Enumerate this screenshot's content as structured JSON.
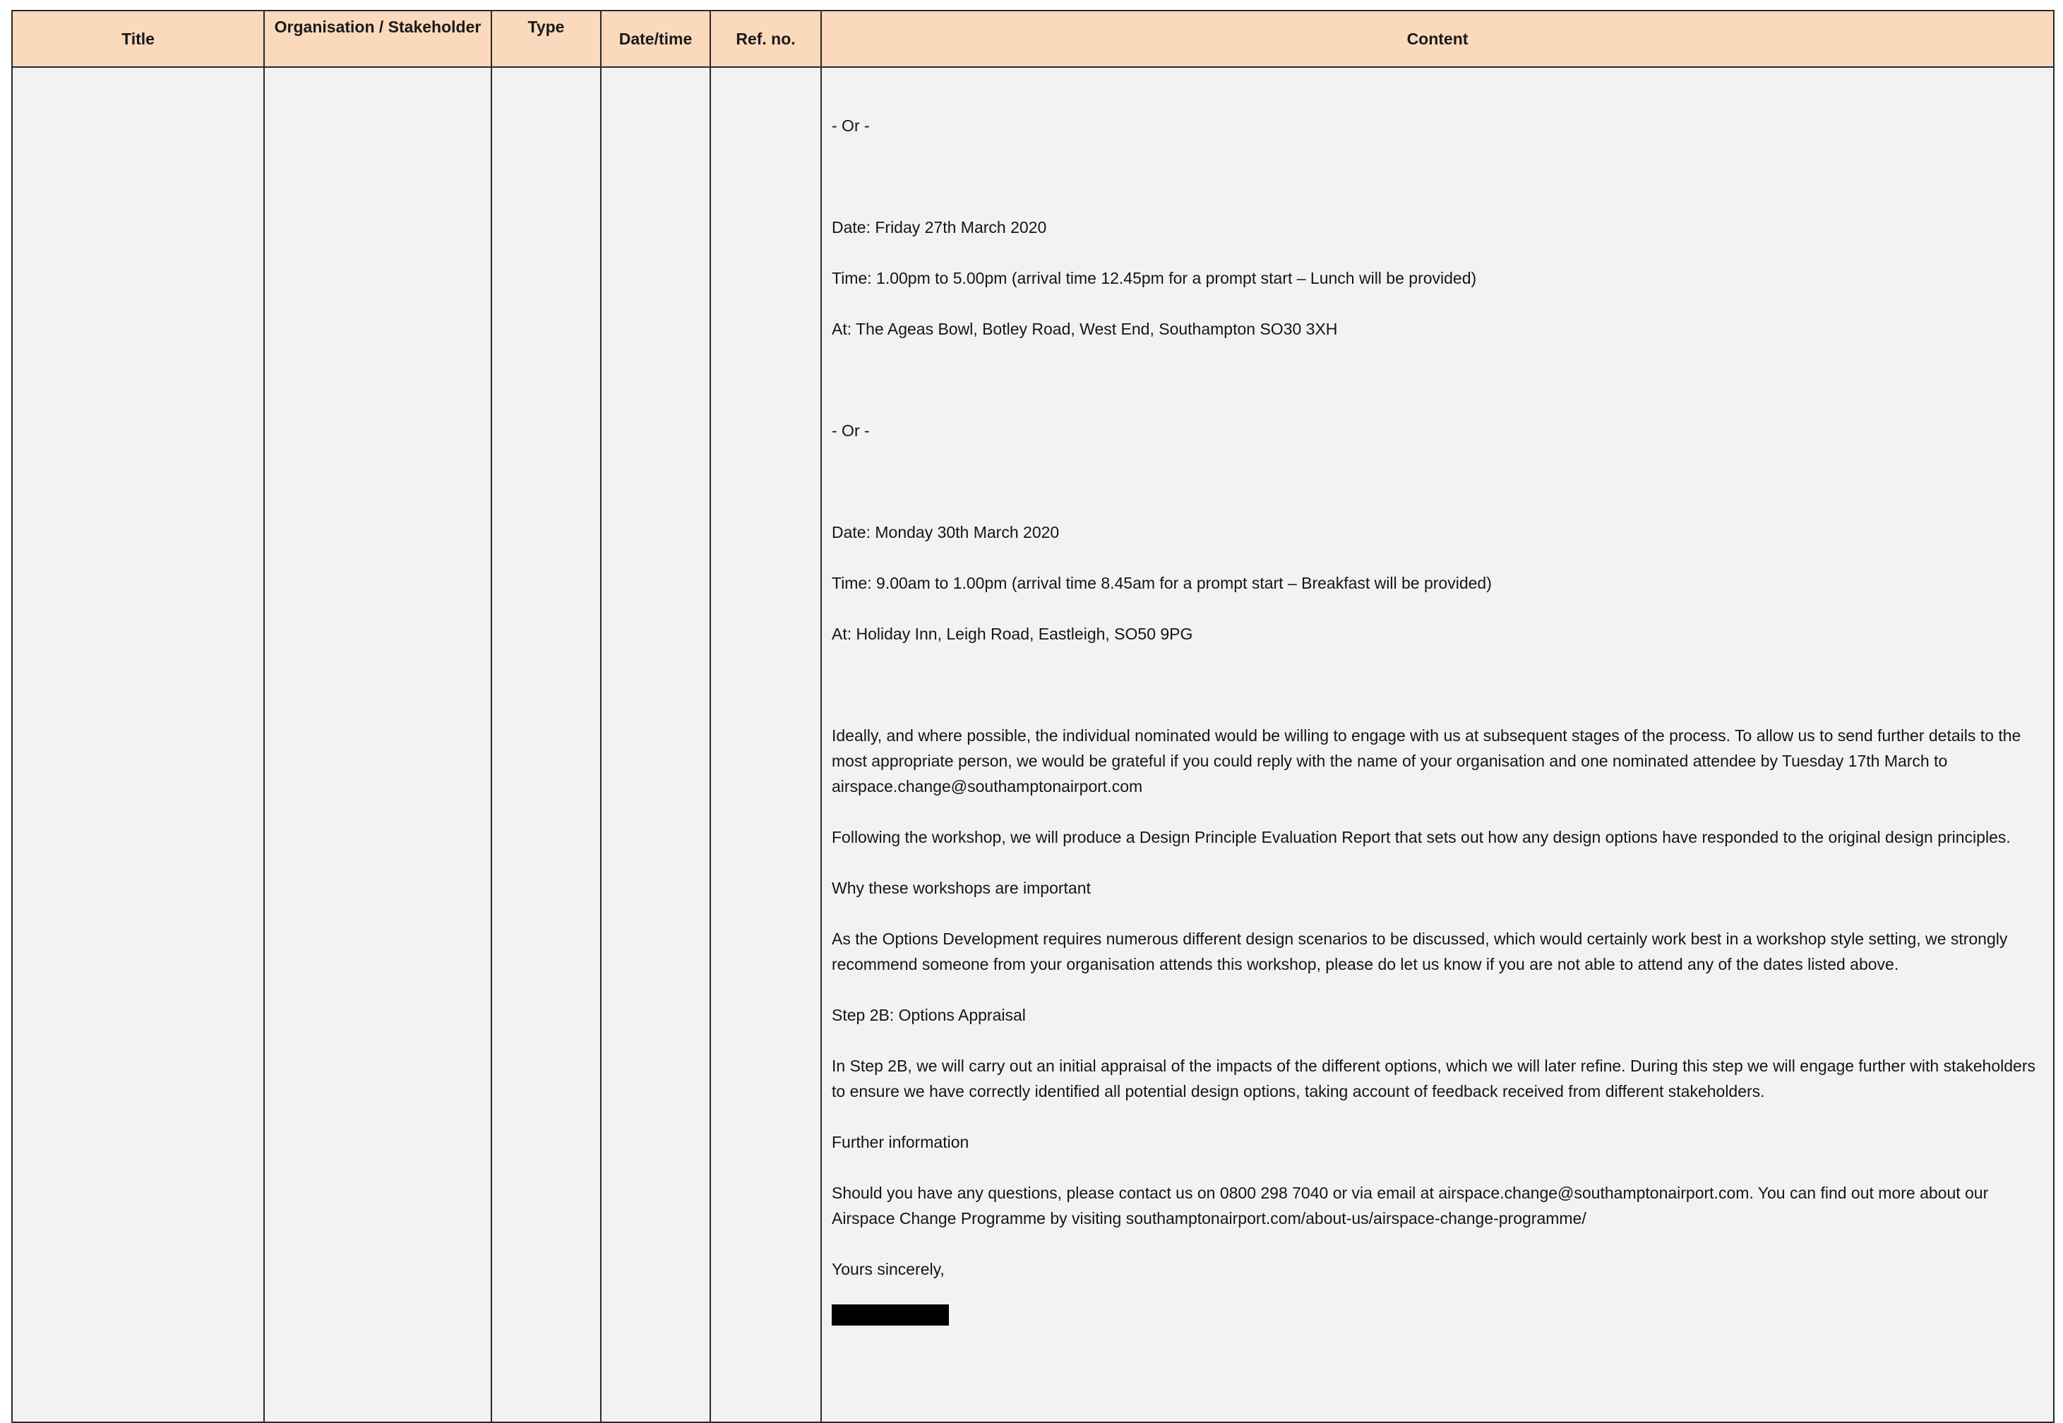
{
  "table": {
    "headers": {
      "title": "Title",
      "organisation": "Organisation / Stakeholder",
      "type": "Type",
      "datetime": "Date/time",
      "ref": "Ref. no.",
      "content": "Content"
    },
    "content": {
      "or_1": "- Or -",
      "date_1": "Date: Friday 27th March 2020",
      "time_1": "Time: 1.00pm to 5.00pm (arrival time 12.45pm for a prompt start – Lunch will be provided)",
      "at_1": "At: The Ageas Bowl, Botley Road, West End, Southampton SO30 3XH",
      "or_2": "- Or -",
      "date_2": "Date: Monday 30th March 2020",
      "time_2": "Time: 9.00am to 1.00pm (arrival time 8.45am for a prompt start – Breakfast will be provided)",
      "at_2": "At: Holiday Inn, Leigh Road, Eastleigh, SO50 9PG",
      "ideally": "Ideally, and where possible, the individual nominated would be willing to engage with us at subsequent stages of the process. To allow us to send further details to the most appropriate person, we would be grateful if you could reply with the name of your organisation and one nominated attendee by Tuesday 17th March to airspace.change@southamptonairport.com",
      "following": "Following the workshop, we will produce a Design Principle Evaluation Report that sets out how any design options have responded to the original design principles.",
      "why_heading": "Why these workshops are important",
      "why_body": "As the Options Development requires numerous different design scenarios to be discussed, which would certainly work best in a workshop style setting, we strongly recommend someone from your organisation attends this workshop, please do let us know if you are not able to attend any of the dates listed above.",
      "step_heading": "Step 2B: Options Appraisal",
      "step_body": "In Step 2B, we will carry out an initial appraisal of the impacts of the different options, which we will later refine. During this step we will engage further with stakeholders to ensure we have correctly identified all potential design options, taking account of feedback received from different stakeholders.",
      "further_heading": "Further information",
      "further_body": "Should you have any questions, please contact us on 0800 298 7040 or via email at airspace.change@southamptonairport.com.  You can find out more about our Airspace Change Programme by visiting southamptonairport.com/about-us/airspace-change-programme/",
      "signoff": "Yours sincerely,"
    }
  }
}
